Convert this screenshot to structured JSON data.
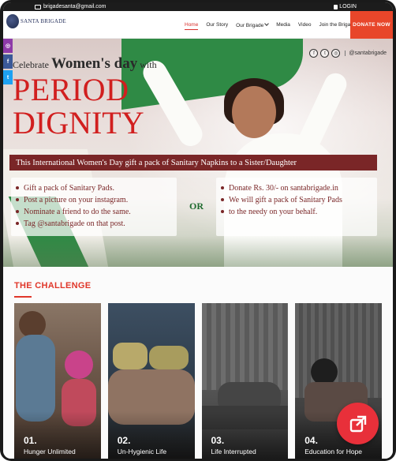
{
  "topbar": {
    "email": "brigadesanta@gmail.com",
    "login_label": "LOGIN"
  },
  "logo": {
    "text": "SANTA BRIGADE"
  },
  "nav": {
    "items": [
      {
        "label": "Home",
        "active": true
      },
      {
        "label": "Our Story"
      },
      {
        "label": "Our Brigade"
      },
      {
        "label": "Media"
      },
      {
        "label": "Video"
      },
      {
        "label": "Join the Brigade"
      }
    ],
    "donate_label": "DONATE NOW"
  },
  "hero": {
    "celebrate_prefix": "Celebrate",
    "celebrate_highlight": "Women's day",
    "celebrate_suffix": "with",
    "headline_1": "PERIOD",
    "headline_2": "DIGNITY",
    "banner": "This International Women's Day gift a pack of Sanitary Napkins to a Sister/Daughter",
    "social_handle": "@santabrigade",
    "or_label": "OR",
    "left_list": [
      "Gift a pack of Sanitary Pads.",
      "Post a picture on your instagram.",
      "Nominate a friend to do the same.",
      "Tag @santabrigade on that post."
    ],
    "right_list": [
      "Donate Rs. 30/- on santabrigade.in",
      "We will gift a pack of Sanitary Pads",
      "to the needy on your behalf."
    ]
  },
  "social_rail": [
    {
      "icon": "instagram-icon",
      "glyph": "◎"
    },
    {
      "icon": "facebook-icon",
      "glyph": "f"
    },
    {
      "icon": "twitter-icon",
      "glyph": "t"
    }
  ],
  "challenge": {
    "title": "THE CHALLENGE",
    "cards": [
      {
        "number": "01.",
        "label": "Hunger Unlimited"
      },
      {
        "number": "02.",
        "label": "Un-Hygienic Life"
      },
      {
        "number": "03.",
        "label": "Life Interrupted"
      },
      {
        "number": "04.",
        "label": "Education for Hope"
      }
    ]
  },
  "colors": {
    "accent_red": "#e0372a",
    "headline_red": "#d11f1f",
    "maroon": "#7a2627",
    "donate_orange": "#e8462a",
    "share_red": "#e8303a",
    "or_green": "#1f6b2e"
  }
}
